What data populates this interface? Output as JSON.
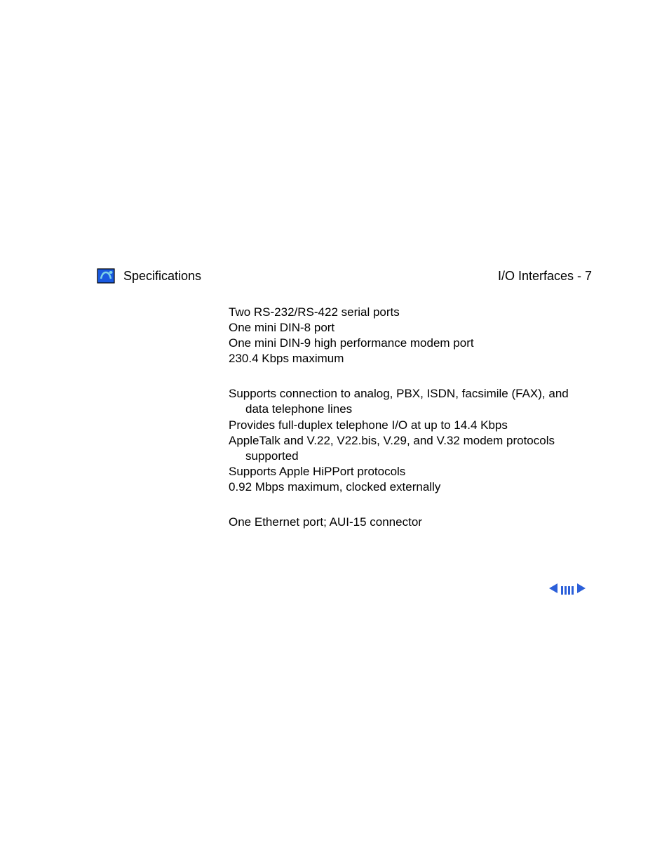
{
  "header": {
    "section_title": "Specifications",
    "page_location": "I/O Interfaces - 7"
  },
  "body": {
    "block1": {
      "line1": "Two RS-232/RS-422 serial ports",
      "line2": "One mini DIN-8 port",
      "line3": "One mini DIN-9 high performance modem port",
      "line4": "230.4 Kbps maximum"
    },
    "block2": {
      "line1": "Supports connection to analog, PBX, ISDN, facsimile (FAX), and data telephone lines",
      "line2": "Provides full-duplex telephone I/O at up to 14.4 Kbps",
      "line3": "AppleTalk and V.22, V22.bis, V.29, and V.32 modem protocols supported",
      "line4": "Supports Apple HiPPort protocols",
      "line5": "0.92 Mbps maximum, clocked externally"
    },
    "block3": {
      "line1": "One Ethernet port; AUI-15 connector"
    }
  },
  "nav": {
    "prev_color": "#2b5fd9",
    "next_color": "#2b5fd9"
  }
}
